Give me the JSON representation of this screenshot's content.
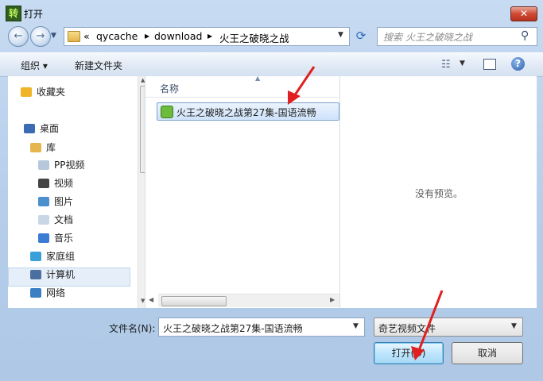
{
  "window": {
    "title": "打开",
    "app_icon_glyph": "转",
    "close_label": "✕"
  },
  "address": {
    "overflow": "«",
    "crumbs": [
      "qycache",
      "download",
      "火王之破晓之战"
    ]
  },
  "search": {
    "placeholder": "搜索 火王之破晓之战"
  },
  "toolbar": {
    "organize_label": "组织 ▾",
    "new_folder_label": "新建文件夹",
    "help_label": "?"
  },
  "nav": {
    "items": [
      {
        "label": "收藏夹",
        "icon": "star-icon",
        "color": "#f0b429"
      },
      {
        "label": "桌面",
        "icon": "desktop-icon",
        "color": "#3d6bb3"
      },
      {
        "label": "库",
        "icon": "library-icon",
        "color": "#e4b64c"
      },
      {
        "label": "PP视频",
        "icon": "library-item-icon",
        "color": "#b8c8dc"
      },
      {
        "label": "视频",
        "icon": "video-icon",
        "color": "#444444"
      },
      {
        "label": "图片",
        "icon": "picture-icon",
        "color": "#4c8fcf"
      },
      {
        "label": "文档",
        "icon": "document-icon",
        "color": "#c9d6e6"
      },
      {
        "label": "音乐",
        "icon": "music-icon",
        "color": "#3b7bd4"
      },
      {
        "label": "家庭组",
        "icon": "homegroup-icon",
        "color": "#3aa0d8"
      },
      {
        "label": "计算机",
        "icon": "computer-icon",
        "color": "#4b6fa0"
      },
      {
        "label": "网络",
        "icon": "network-icon",
        "color": "#3a7fc4"
      }
    ]
  },
  "files": {
    "column_name": "名称",
    "items": [
      {
        "name": "火王之破晓之战第27集-国语流畅"
      }
    ]
  },
  "preview": {
    "empty_text": "没有预览。"
  },
  "bottom": {
    "filename_label": "文件名(N):",
    "filename_value": "火王之破晓之战第27集-国语流畅",
    "filter_value": "奇艺视频文件",
    "open_label": "打开(O)",
    "cancel_label": "取消"
  },
  "colors": {
    "annotation_arrow": "#e02020",
    "selection": "#cfe3fb"
  }
}
